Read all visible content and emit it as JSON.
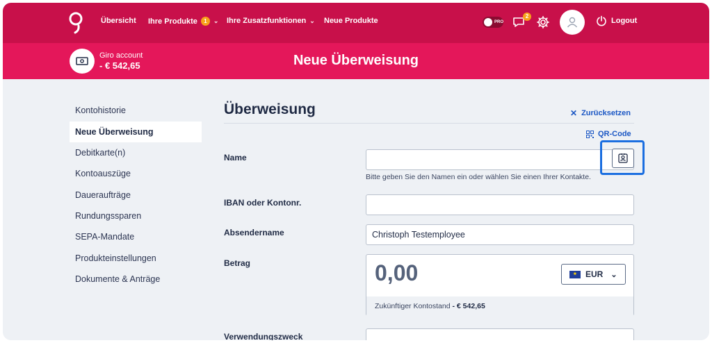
{
  "nav": {
    "items": [
      {
        "label": "Übersicht"
      },
      {
        "label": "Ihre Produkte",
        "badge": "1"
      },
      {
        "label": "Ihre Zusatzfunktionen"
      },
      {
        "label": "Neue Produkte"
      }
    ],
    "pro_label": "PRO",
    "chat_badge": "2",
    "logout_label": "Logout"
  },
  "account": {
    "name": "Giro account",
    "balance": "- € 542,65"
  },
  "page": {
    "title": "Neue Überweisung"
  },
  "sidebar": {
    "items": [
      {
        "label": "Kontohistorie"
      },
      {
        "label": "Neue Überweisung",
        "active": true
      },
      {
        "label": "Debitkarte(n)"
      },
      {
        "label": "Kontoauszüge"
      },
      {
        "label": "Daueraufträge"
      },
      {
        "label": "Rundungssparen"
      },
      {
        "label": "SEPA-Mandate"
      },
      {
        "label": "Produkteinstellungen"
      },
      {
        "label": "Dokumente & Anträge"
      }
    ]
  },
  "form": {
    "title": "Überweisung",
    "reset_label": "Zurücksetzen",
    "qr_label": "QR-Code",
    "name_label": "Name",
    "name_value": "",
    "name_hint": "Bitte geben Sie den Namen ein oder wählen Sie einen Ihrer Kontakte.",
    "iban_label": "IBAN oder Kontonr.",
    "iban_value": "",
    "sender_label": "Absendername",
    "sender_value": "Christoph Testemployee",
    "amount_label": "Betrag",
    "amount_value": "0,00",
    "currency": "EUR",
    "future_balance_label": "Zukünftiger Kontostand",
    "future_balance_value": "- € 542,65",
    "purpose_label": "Verwendungszweck",
    "purpose_value": ""
  },
  "colors": {
    "topnav": "#c8104a",
    "subheader": "#e4175a",
    "link": "#1a56c4",
    "focus": "#1a6ee0"
  }
}
